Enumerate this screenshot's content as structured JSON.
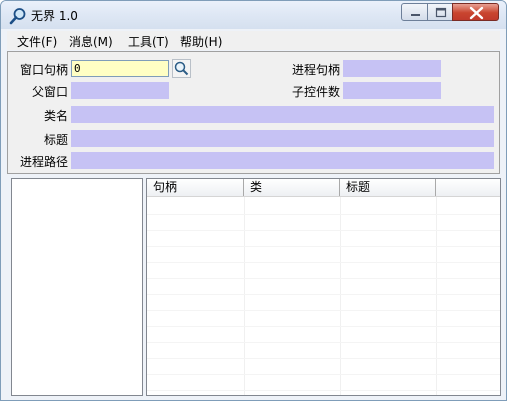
{
  "window": {
    "title": "无界 1.0",
    "icon": "magnifier-icon"
  },
  "menu": [
    {
      "label": "文件(F)"
    },
    {
      "label": "消息(M)"
    },
    {
      "label": "工具(T)"
    },
    {
      "label": "帮助(H)"
    }
  ],
  "fields": {
    "window_handle": {
      "label": "窗口句柄",
      "value": "0"
    },
    "parent_window": {
      "label": "父窗口",
      "value": ""
    },
    "process_handle": {
      "label": "进程句柄",
      "value": ""
    },
    "child_count": {
      "label": "子控件数",
      "value": ""
    },
    "class_name": {
      "label": "类名",
      "value": ""
    },
    "title": {
      "label": "标题",
      "value": ""
    },
    "process_path": {
      "label": "进程路径",
      "value": ""
    }
  },
  "list": {
    "columns": [
      "句柄",
      "类",
      "标题",
      ""
    ],
    "rows": []
  },
  "colors": {
    "field_fill": "#c6c2f4",
    "input_fill": "#ffffc4"
  }
}
